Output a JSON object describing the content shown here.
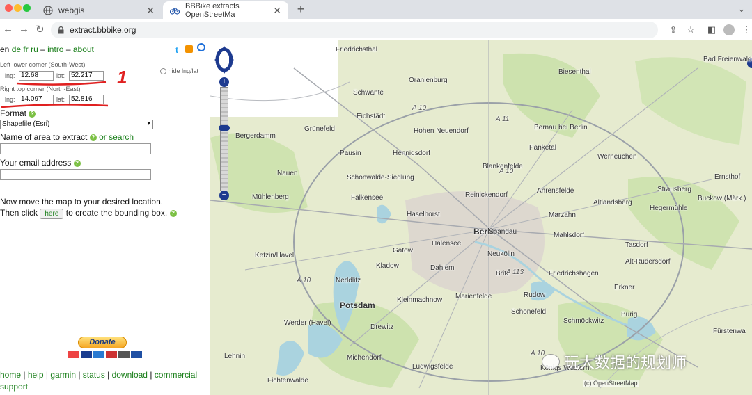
{
  "tabs": [
    {
      "title": "webgis"
    },
    {
      "title": "BBBike extracts OpenStreetMa"
    }
  ],
  "address": {
    "url": "extract.bbbike.org"
  },
  "panel": {
    "lang_current": "en",
    "lang_links": [
      "de",
      "fr",
      "ru"
    ],
    "sep": "–",
    "intro": "intro",
    "about": "about",
    "sw_label": "Left lower corner (South-West)",
    "ne_label": "Right top corner (North-East)",
    "lng_label": "lng:",
    "lat_label": "lat:",
    "sw_lng": "12.68",
    "sw_lat": "52.217",
    "ne_lng": "14.097",
    "ne_lat": "52.816",
    "hide_label": "hide lng/lat",
    "format_label": "Format",
    "format_value": "Shapefile (Esri)",
    "name_label": "Name of area to extract",
    "or_search": "or search",
    "email_label": "Your email address",
    "instr1": "Now move the map to your desired location.",
    "instr2_a": "Then click",
    "here_button": "here",
    "instr2_b": "to create the bounding box.",
    "donate": "Donate",
    "footer_links": [
      "home",
      "help",
      "garmin",
      "status",
      "download",
      "commercial",
      "support"
    ],
    "annotation_mark": "1"
  },
  "map": {
    "labels": [
      "Friedrichsthal",
      "Bad Freienwalde",
      "Oranienburg",
      "Biesenthal",
      "Schwante",
      "Eichstädt",
      "Hohen Neuendorf",
      "Bernau bei Berlin",
      "Grünefeld",
      "Bergerdamm",
      "Pausin",
      "Hennigsdorf",
      "Panketal",
      "Werneuchen",
      "Blankenfelde",
      "Ernsthof",
      "Nauen",
      "Schönwalde-Siedlung",
      "Strausberg",
      "Ahrensfelde",
      "Mühlenberg",
      "Falkensee",
      "Reinickendorf",
      "Altlandsberg",
      "Buckow (Märk.)",
      "Hegermühle",
      "Haselhorst",
      "Berlin",
      "Spandau",
      "Marzahn",
      "Mahlsdorf",
      "Halensee",
      "Ketzin/Havel",
      "Gatow",
      "Neukölln",
      "Tasdorf",
      "Alt-Rüdersdorf",
      "Kladow",
      "Dahlem",
      "Britz",
      "Friedrichshagen",
      "Neddlitz",
      "Erkner",
      "Potsdam",
      "Kleinmachnow",
      "Marienfelde",
      "Rudow",
      "Schönefeld",
      "Burig",
      "Werder (Havel)",
      "Drewitz",
      "Schmöckwitz",
      "Fürstenwa",
      "Lehnin",
      "Michendorf",
      "Ludwigsfelde",
      "Fichtenwalde",
      "Königs Wusterh."
    ],
    "road_labels": [
      "A 10",
      "A 11",
      "A 10",
      "A 113",
      "A 10",
      "A 10"
    ],
    "attribution": "(c) OpenStreetMap",
    "watermark": "玩大数据的规划师"
  }
}
